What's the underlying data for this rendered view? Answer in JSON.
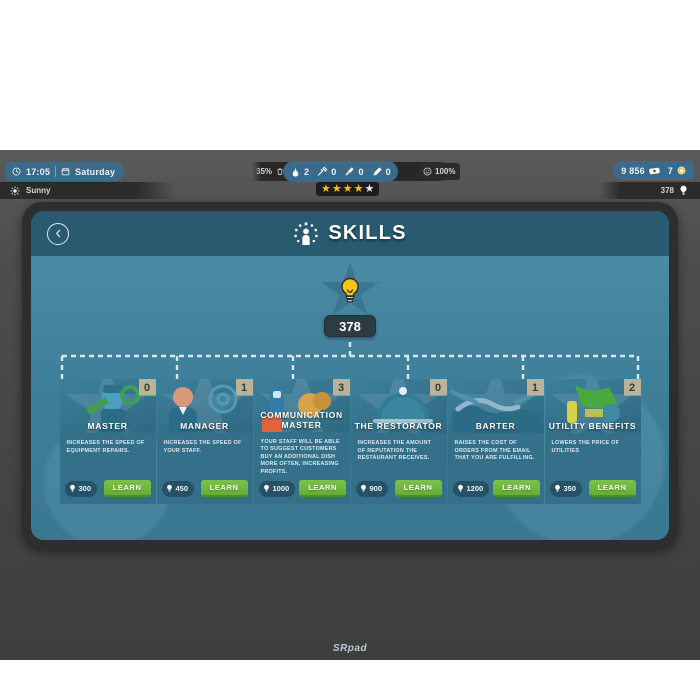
{
  "hud": {
    "clock": {
      "time": "17:05",
      "day": "Saturday",
      "clock_icon": "clock-icon",
      "calendar_icon": "calendar-icon"
    },
    "weather": {
      "label": "Sunny",
      "icon": "sun-icon"
    },
    "stats": {
      "cleanliness": "35%",
      "cleanliness_icon": "trash-icon",
      "mood": "100%",
      "mood_icon": "smiley-icon"
    },
    "supplies": [
      {
        "name": "supply-food",
        "icon": "food-bag-icon",
        "value": "2"
      },
      {
        "name": "supply-tools",
        "icon": "tools-icon",
        "value": "0"
      },
      {
        "name": "supply-cleaning",
        "icon": "mop-icon",
        "value": "0"
      },
      {
        "name": "supply-paint",
        "icon": "brush-icon",
        "value": "0"
      }
    ],
    "rating": {
      "total": 5,
      "filled": 4
    },
    "money": {
      "cash": "9 856",
      "cash_icon": "money-icon",
      "gems": "7",
      "gems_icon": "gem-icon"
    },
    "points": {
      "value": "378",
      "icon": "bulb-icon"
    }
  },
  "modal": {
    "title": "SKILLS",
    "title_icon": "skills-icon",
    "back_icon": "chevron-left-icon",
    "root": {
      "value": "378",
      "icon": "bulb-icon"
    },
    "watermark": "SRpad",
    "cards": [
      {
        "name": "MASTER",
        "level": "0",
        "description": "INCREASES THE SPEED OF EQUIPMENT REPAIRS.",
        "cost": "300",
        "cost_icon": "bulb-icon",
        "button": "LEARN"
      },
      {
        "name": "MANAGER",
        "level": "1",
        "description": "INCREASES THE SPEED OF YOUR STAFF.",
        "cost": "450",
        "cost_icon": "bulb-icon",
        "button": "LEARN"
      },
      {
        "name": "COMMUNICATION MASTER",
        "level": "3",
        "description": "YOUR STAFF WILL BE ABLE TO SUGGEST CUSTOMERS BUY AN ADDITIONAL DISH MORE OFTEN, INCREASING PROFITS.",
        "cost": "1000",
        "cost_icon": "bulb-icon",
        "button": "LEARN"
      },
      {
        "name": "THE RESTORATOR",
        "level": "0",
        "description": "INCREASES THE AMOUNT OF REPUTATION THE RESTAURANT RECEIVES.",
        "cost": "900",
        "cost_icon": "bulb-icon",
        "button": "LEARN"
      },
      {
        "name": "BARTER",
        "level": "1",
        "description": "RAISES THE COST OF ORDERS FROM THE EMAIL THAT YOU ARE FULFILLING.",
        "cost": "1200",
        "cost_icon": "bulb-icon",
        "button": "LEARN"
      },
      {
        "name": "UTILITY BENEFITS",
        "level": "2",
        "description": "LOWERS THE PRICE OF UTILITIES",
        "cost": "350",
        "cost_icon": "bulb-icon",
        "button": "LEARN"
      }
    ]
  },
  "colors": {
    "accent": "#3a6a8c",
    "panel": "#3e7f9a",
    "header": "#285a70",
    "learn": "#6eb83e",
    "badge": "#b9b39a",
    "star_on": "#f5bf18",
    "star_off": "#e8e8e8"
  }
}
